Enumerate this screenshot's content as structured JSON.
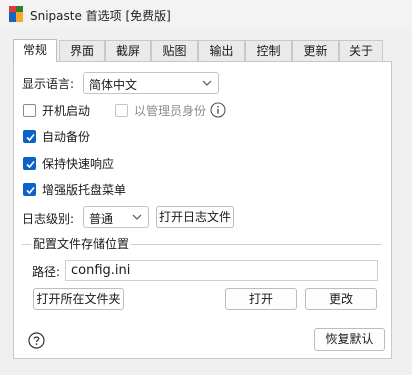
{
  "window": {
    "title": "Snipaste 首选项 [免费版]"
  },
  "tabs": [
    {
      "label": "常规"
    },
    {
      "label": "界面"
    },
    {
      "label": "截屏"
    },
    {
      "label": "贴图"
    },
    {
      "label": "输出"
    },
    {
      "label": "控制"
    },
    {
      "label": "更新"
    },
    {
      "label": "关于"
    }
  ],
  "general": {
    "language_label": "显示语言:",
    "language_value": "简体中文",
    "startup_label": "开机启动",
    "startup_checked": false,
    "run_as_admin_label": "以管理员身份",
    "run_as_admin_checked": false,
    "auto_backup_label": "自动备份",
    "auto_backup_checked": true,
    "keep_responsive_label": "保持快速响应",
    "keep_responsive_checked": true,
    "enhanced_tray_label": "增强版托盘菜单",
    "enhanced_tray_checked": true,
    "log_level_label": "日志级别:",
    "log_level_value": "普通",
    "open_log_button": "打开日志文件"
  },
  "config_group": {
    "title": "配置文件存储位置",
    "path_label": "路径:",
    "path_value": "config.ini",
    "open_folder_button": "打开所在文件夹",
    "open_button": "打开",
    "change_button": "更改"
  },
  "footer": {
    "help_icon": "help-icon",
    "restore_defaults_button": "恢复默认"
  },
  "colors": {
    "accent": "#0a64c8",
    "window_bg": "#f0f0f0",
    "panel_bg": "#ffffff"
  }
}
